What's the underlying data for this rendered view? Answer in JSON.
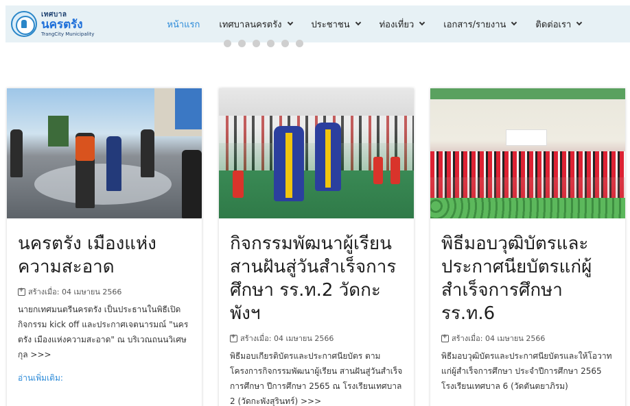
{
  "logo": {
    "line1": "เทศบาล",
    "line2": "นครตรัง",
    "line3": "TrangCity Municipality"
  },
  "nav": {
    "items": [
      {
        "label": "หน้าแรก",
        "active": true,
        "dropdown": false
      },
      {
        "label": "เทศบาลนครตรัง",
        "active": false,
        "dropdown": true
      },
      {
        "label": "ประชาชน",
        "active": false,
        "dropdown": true
      },
      {
        "label": "ท่องเที่ยว",
        "active": false,
        "dropdown": true
      },
      {
        "label": "เอกสาร/รายงาน",
        "active": false,
        "dropdown": true
      },
      {
        "label": "ติดต่อเรา",
        "active": false,
        "dropdown": true
      }
    ]
  },
  "carousel": {
    "dot_count": 6
  },
  "cards": [
    {
      "title": "นครตรัง เมืองแห่งความสะอาด",
      "date": "สร้างเมื่อ: 04 เมษายน 2566",
      "excerpt": "นายกเทศมนตรีนครตรัง เป็นประธานในพิธีเปิดกิจกรรม kick off และประกาศเจตนารมณ์ \"นครตรัง เมืองแห่งความสะอาด\" ณ บริเวณถนนวิเศษกุล >>>",
      "read_more": "อ่านเพิ่มเติม:"
    },
    {
      "title": "กิจกรรมพัฒนาผู้เรียน สานฝันสู่วันสำเร็จการศึกษา รร.ท.2 วัดกะพังฯ",
      "date": "สร้างเมื่อ: 04 เมษายน 2566",
      "excerpt": "พิธีมอบเกียรติบัตรและประกาศนียบัตร ตามโครงการกิจกรรมพัฒนาผู้เรียน สานฝันสู่วันสำเร็จการศึกษา ปีการศึกษา 2565 ณ โรงเรียนเทศบาล 2 (วัดกะพังสุรินทร์) >>>"
    },
    {
      "title": "พิธีมอบวุฒิบัตรและประกาศนียบัตรแก่ผู้สำเร็จการศึกษา รร.ท.6",
      "date": "สร้างเมื่อ: 04 เมษายน 2566",
      "excerpt": "พิธีมอบวุฒิบัตรและประกาศนียบัตรและให้โอวาทแก่ผู้สำเร็จการศึกษา ประจำปีการศึกษา 2565 โรงเรียนเทศบาล 6 (วัดตันตยาภิรม)"
    }
  ],
  "colors": {
    "accent": "#2b8ad8",
    "nav_bg": "#e7f1f5",
    "title": "#1e1e1e"
  }
}
